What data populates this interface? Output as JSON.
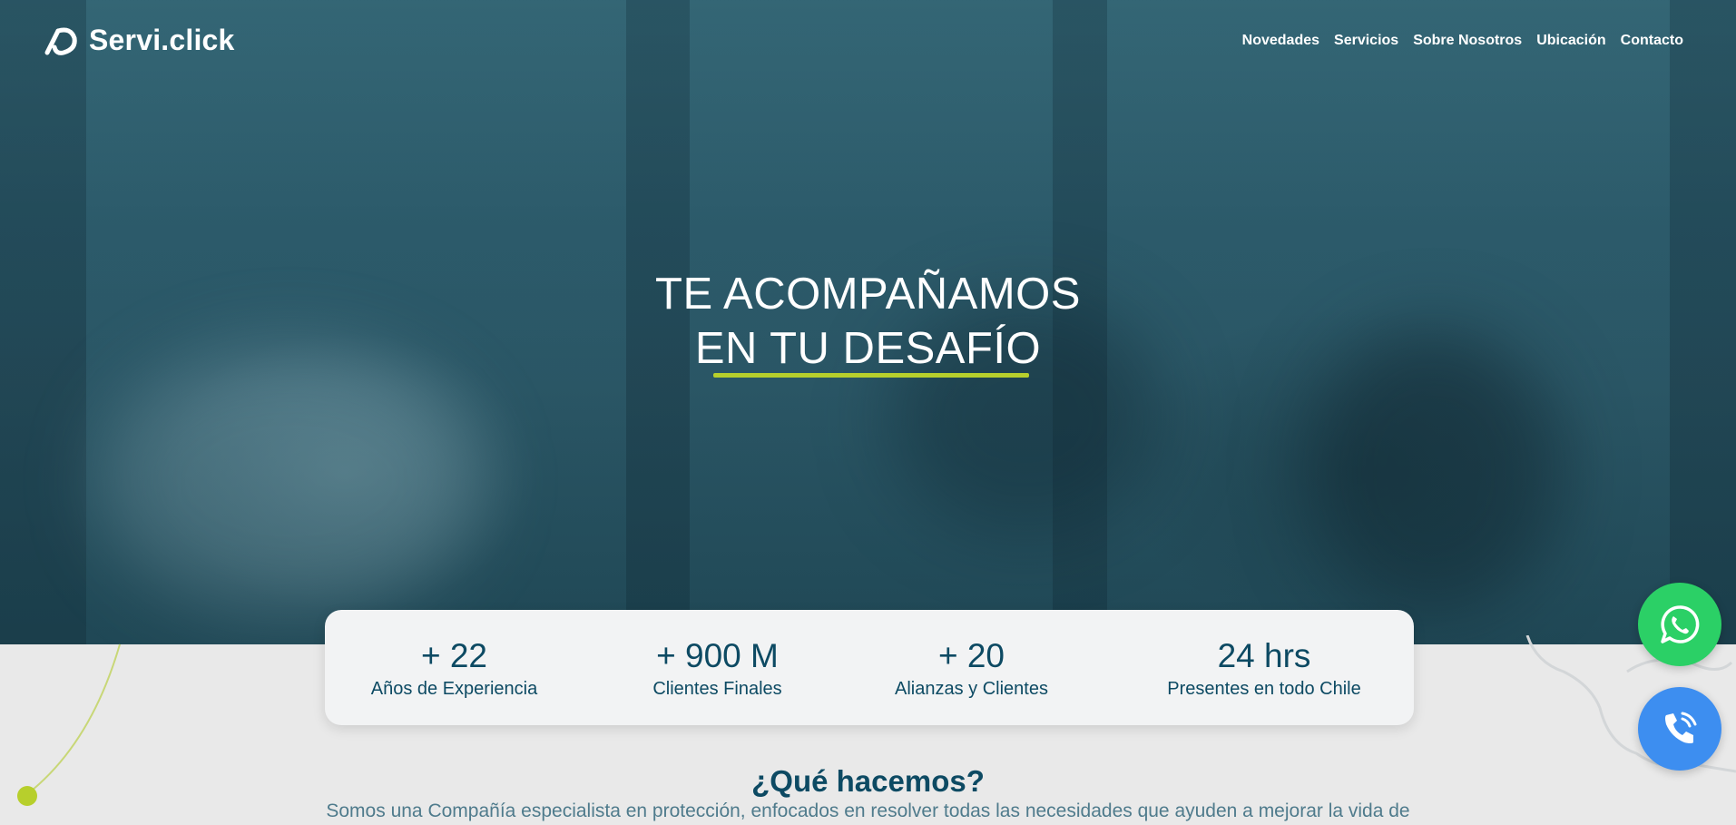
{
  "brand": {
    "name": "Servi.click",
    "accent": "#b7cf2c",
    "primary": "#0d4a63"
  },
  "nav": [
    "Novedades",
    "Servicios",
    "Sobre Nosotros",
    "Ubicación",
    "Contacto"
  ],
  "hero": {
    "line1": "TE ACOMPAÑAMOS",
    "line2": "EN TU DESAFÍO"
  },
  "stats": [
    {
      "value": "+ 22",
      "label": "Años de Experiencia"
    },
    {
      "value": "+ 900 M",
      "label": "Clientes Finales"
    },
    {
      "value": "+ 20",
      "label": "Alianzas y Clientes"
    },
    {
      "value": "24 hrs",
      "label": "Presentes en todo Chile"
    }
  ],
  "about": {
    "title": "¿Qué hacemos?",
    "text": "Somos una Compañía especialista en protección, enfocados en resolver todas las necesidades que ayuden a mejorar la vida de"
  },
  "floating": {
    "whatsapp_icon": "whatsapp-icon",
    "phone_icon": "phone-icon",
    "whatsapp_color": "#2bd066",
    "phone_color": "#3d8ef0"
  }
}
